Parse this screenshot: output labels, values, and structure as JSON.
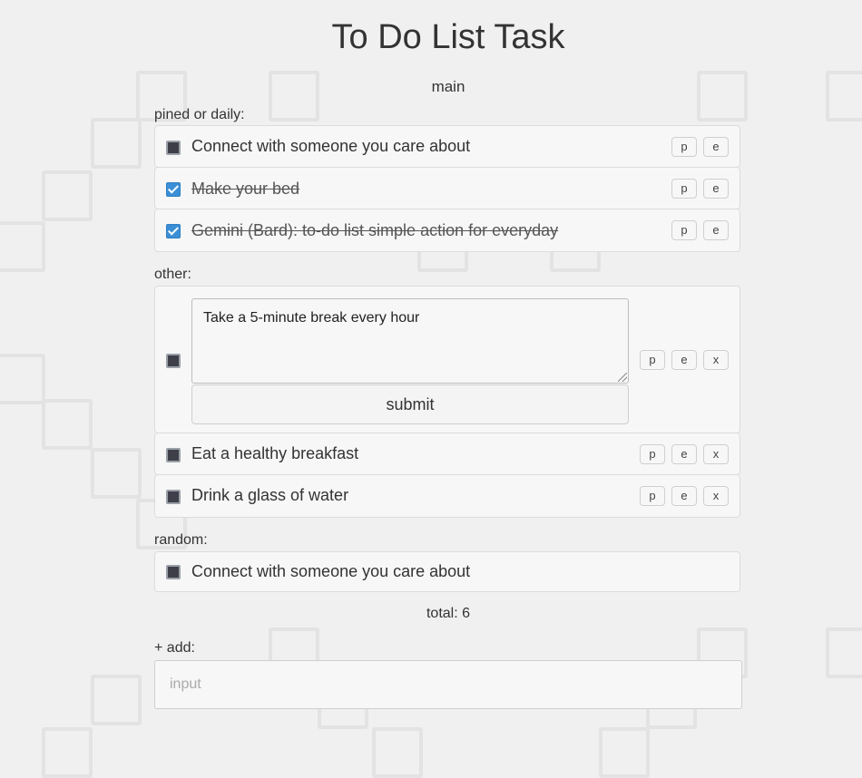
{
  "title": "To Do List Task",
  "list_name": "main",
  "sections": {
    "pinned_label": "pined or daily:",
    "other_label": "other:",
    "random_label": "random:"
  },
  "pinned_tasks": [
    {
      "text": "Connect with someone you care about",
      "checked": false,
      "pin_label": "p",
      "edit_label": "e"
    },
    {
      "text": "Make your bed",
      "checked": true,
      "pin_label": "p",
      "edit_label": "e"
    },
    {
      "text": "Gemini (Bard): to-do list simple action for everyday",
      "checked": true,
      "pin_label": "p",
      "edit_label": "e"
    }
  ],
  "other_tasks": [
    {
      "text": "Take a 5-minute break every hour",
      "checked": false,
      "editing": true,
      "submit_label": "submit",
      "pin_label": "p",
      "edit_label": "e",
      "delete_label": "x"
    },
    {
      "text": "Eat a healthy breakfast",
      "checked": false,
      "pin_label": "p",
      "edit_label": "e",
      "delete_label": "x"
    },
    {
      "text": "Drink a glass of water",
      "checked": false,
      "pin_label": "p",
      "edit_label": "e",
      "delete_label": "x"
    }
  ],
  "random_tasks": [
    {
      "text": "Connect with someone you care about",
      "checked": false
    }
  ],
  "total_text": "total: 6",
  "add": {
    "label": "+ add:",
    "placeholder": "input"
  },
  "colors": {
    "background": "#f0f0f0",
    "checkbox_checked": "#3a8fd6",
    "checkbox_unchecked": "#3f3f4a",
    "text": "#333333"
  }
}
